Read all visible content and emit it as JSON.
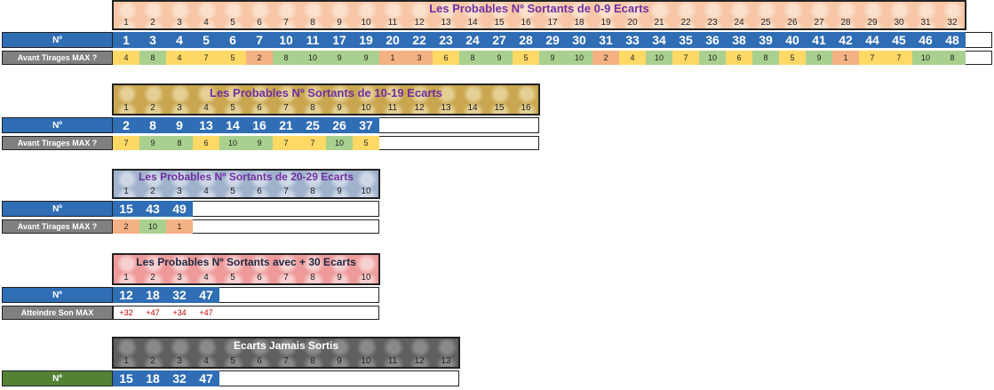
{
  "colors": {
    "green": "#a9d08e",
    "yellow": "#ffd966",
    "orange": "#f4b183",
    "blue_num": "#2f6db5",
    "green_label": "#548235",
    "gray_label": "#808080",
    "red_text": "#c00000",
    "purple_title": "#7030a0"
  },
  "section1": {
    "title": "Les Probables Nº Sortants de 0-9 Ecarts",
    "label_no": "Nº",
    "label_max": "Avant Tirages MAX ?",
    "indices": [
      "1",
      "2",
      "3",
      "4",
      "5",
      "6",
      "7",
      "8",
      "9",
      "10",
      "11",
      "12",
      "13",
      "14",
      "15",
      "16",
      "17",
      "18",
      "19",
      "20",
      "21",
      "22",
      "23",
      "24",
      "25",
      "26",
      "27",
      "28",
      "29",
      "30",
      "31",
      "32"
    ],
    "numbers": [
      "1",
      "3",
      "4",
      "5",
      "6",
      "7",
      "10",
      "11",
      "17",
      "19",
      "20",
      "22",
      "23",
      "24",
      "27",
      "28",
      "29",
      "30",
      "31",
      "33",
      "34",
      "35",
      "36",
      "38",
      "39",
      "40",
      "41",
      "42",
      "44",
      "45",
      "46",
      "48"
    ],
    "values": [
      "4",
      "8",
      "4",
      "7",
      "5",
      "2",
      "8",
      "10",
      "9",
      "9",
      "1",
      "3",
      "6",
      "8",
      "9",
      "5",
      "9",
      "10",
      "2",
      "4",
      "10",
      "7",
      "10",
      "6",
      "8",
      "5",
      "9",
      "1",
      "7",
      "7",
      "10",
      "8"
    ],
    "value_colors": [
      "yellow",
      "green",
      "yellow",
      "yellow",
      "yellow",
      "orange",
      "green",
      "green",
      "green",
      "green",
      "orange",
      "orange",
      "yellow",
      "green",
      "green",
      "yellow",
      "green",
      "green",
      "orange",
      "yellow",
      "green",
      "yellow",
      "green",
      "yellow",
      "green",
      "yellow",
      "green",
      "orange",
      "yellow",
      "yellow",
      "green",
      "green"
    ]
  },
  "section2": {
    "title": "Les Probables Nº Sortants de 10-19 Ecarts",
    "label_no": "Nº",
    "label_max": "Avant Tirages MAX ?",
    "indices": [
      "1",
      "2",
      "3",
      "4",
      "5",
      "6",
      "7",
      "8",
      "9",
      "10",
      "11",
      "12",
      "13",
      "14",
      "15",
      "16"
    ],
    "numbers": [
      "2",
      "8",
      "9",
      "13",
      "14",
      "16",
      "21",
      "25",
      "26",
      "37"
    ],
    "values": [
      "7",
      "9",
      "8",
      "6",
      "10",
      "9",
      "7",
      "7",
      "10",
      "5"
    ],
    "value_colors": [
      "yellow",
      "green",
      "green",
      "yellow",
      "green",
      "green",
      "yellow",
      "yellow",
      "green",
      "yellow"
    ]
  },
  "section3": {
    "title": "Les Probables Nº Sortants de 20-29 Ecarts",
    "label_no": "Nº",
    "label_max": "Avant Tirages MAX ?",
    "indices": [
      "1",
      "2",
      "3",
      "4",
      "5",
      "6",
      "7",
      "8",
      "9",
      "10"
    ],
    "numbers": [
      "15",
      "43",
      "49"
    ],
    "values": [
      "2",
      "10",
      "1"
    ],
    "value_colors": [
      "orange",
      "green",
      "orange"
    ]
  },
  "section4": {
    "title": "Les Probables Nº Sortants avec + 30 Ecarts",
    "label_no": "Nº",
    "label_max": "Atteindre Son MAX",
    "indices": [
      "1",
      "2",
      "3",
      "4",
      "5",
      "6",
      "7",
      "8",
      "9",
      "10"
    ],
    "numbers": [
      "12",
      "18",
      "32",
      "47"
    ],
    "values": [
      "+32",
      "+47",
      "+34",
      "+47"
    ]
  },
  "section5": {
    "title": "Ecarts Jamais Sortis",
    "label_no": "Nº",
    "indices": [
      "1",
      "2",
      "3",
      "4",
      "5",
      "6",
      "7",
      "8",
      "9",
      "10",
      "11",
      "12",
      "13"
    ],
    "numbers": [
      "15",
      "18",
      "32",
      "47"
    ]
  }
}
